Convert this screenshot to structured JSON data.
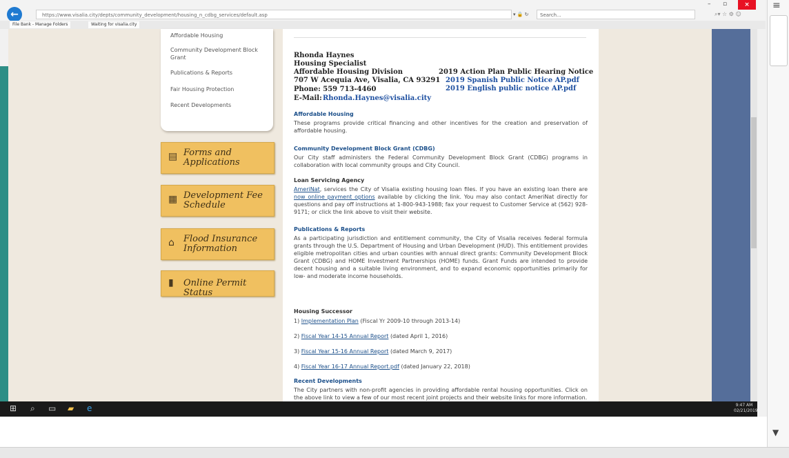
{
  "browser": {
    "back_icon": "back-arrow-icon",
    "address": "https://www.visalia.city/depts/community_development/housing_n_cdbg_services/default.asp",
    "address_tools": "▾ 🔒 ↻",
    "search_placeholder": "Search...",
    "tabs": [
      "File Bank - Manage Folders",
      "Waiting for visalia.city"
    ],
    "window_controls": [
      "–",
      "▫"
    ],
    "close_label": "×",
    "right_icons": "⌕▾  ☆ ⚙ ☺"
  },
  "sidebar": {
    "items": [
      "Affordable Housing",
      "Community Development Block Grant",
      "Publications & Reports",
      "Fair Housing Protection",
      "Recent Developments"
    ]
  },
  "buttons": [
    {
      "label": "Forms and Applications",
      "icon": "document-icon"
    },
    {
      "label": "Development Fee Schedule",
      "icon": "calendar-icon"
    },
    {
      "label": "Flood Insurance Information",
      "icon": "house-icon"
    },
    {
      "label": "Online Permit Status",
      "icon": "file-icon"
    }
  ],
  "contact": {
    "name": "Rhonda Haynes",
    "title": "Housing Specialist",
    "division": "Affordable Housing Division",
    "address": "707 W Acequia Ave, Visalia, CA 93291",
    "phone": "Phone:  559 713-4460",
    "email_label": "E-Mail:",
    "email": "Rhonda.Haynes@visalia.city"
  },
  "notice": {
    "title": "2019 Action Plan Public Hearing Notice",
    "spanish": "2019 Spanish Public Notice AP.pdf",
    "english": "2019 English public notice AP.pdf"
  },
  "sections": {
    "affordable": {
      "heading": "Affordable Housing",
      "body": "These programs provide critical financing and other incentives for the creation and preservation of affordable housing."
    },
    "cdbg": {
      "heading": "Community Development Block Grant (CDBG)",
      "body": "Our City staff administers the Federal Community Development Block Grant (CDBG) programs in collaboration with local community groups and City Council."
    },
    "loan": {
      "heading": "Loan Servicing Agency",
      "link1": "AmeriNat",
      "body1": ", services the City of Visalia existing housing loan files. If you have an existing loan there are",
      "link2": "now online payment options",
      "body2": " available by clicking the link.  You may also contact AmeriNat directly for questions and pay off instructions at 1-800-943-1988; fax your request to Customer Service at (562) 928-9171; or click the link above to visit their website."
    },
    "publications": {
      "heading": "Publications & Reports",
      "body": "As a participating jurisdiction and entitlement community, the City of Visalia receives federal formula grants through the U.S. Department of Housing and Urban Development (HUD).  This entitlement provides eligible metropolitan cities and urban counties with annual direct grants:  Community Development Block Grant (CDBG) and HOME Investment Partnerships (HOME) funds.  Grant Funds are intended to provide decent housing and a suitable living environment, and to expand economic opportunities primarily for low- and moderate income households."
    },
    "successor": {
      "heading": "Housing Successor",
      "items": [
        {
          "num": "1)",
          "link": "Implementation Plan",
          "note": "(Fiscal Yr 2009-10 through 2013-14)"
        },
        {
          "num": "2)",
          "link": "Fiscal Year 14-15 Annual Report",
          "note": "(dated April 1, 2016)"
        },
        {
          "num": "3)",
          "link": "Fiscal Year 15-16 Annual Report",
          "note": "(dated March 9, 2017)"
        },
        {
          "num": "4)",
          "link": "Fiscal Year 16-17 Annual Report.pdf",
          "note": "(dated January 22, 2018)"
        }
      ]
    },
    "recent": {
      "heading": "Recent Developments",
      "body": "The City partners with non-profit agencies in providing affordable rental housing opportunities.  Click on the above link to view a few of our most recent joint projects and their website links for more information."
    }
  },
  "taskbar": {
    "icons": [
      "windows-icon",
      "search-icon",
      "task-view-icon",
      "file-explorer-icon",
      "internet-explorer-icon"
    ],
    "time": "9:47 AM",
    "date": "02/21/2019"
  }
}
